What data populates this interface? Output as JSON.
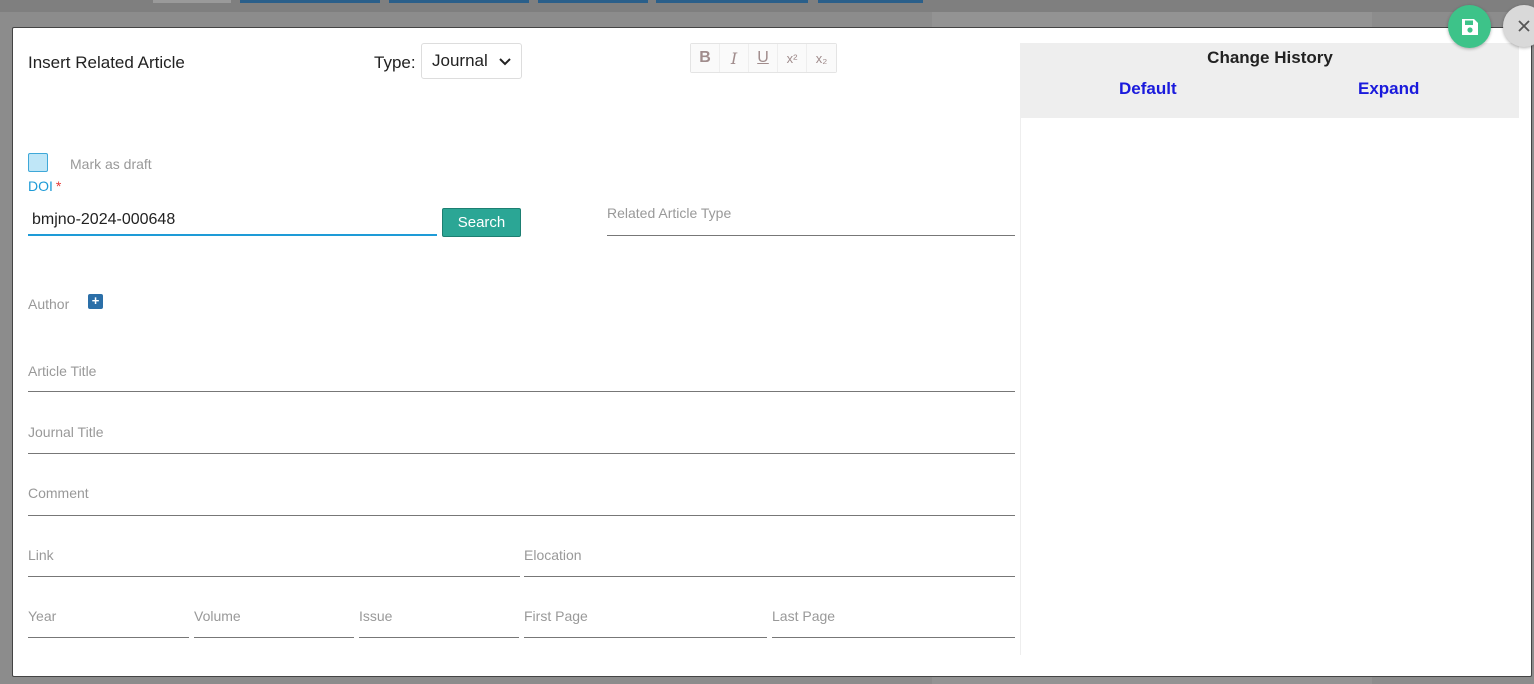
{
  "modal": {
    "title": "Insert Related Article",
    "type_label": "Type:",
    "type_value": "Journal",
    "format_buttons": [
      "B",
      "I",
      "U",
      "x²",
      "x₂"
    ],
    "draft_label": "Mark as draft",
    "doi_label": "DOI",
    "doi_required": "*",
    "doi_value": "bmjno-2024-000648",
    "search_label": "Search",
    "related_type_label": "Related Article Type",
    "author_label": "Author",
    "author_add": "+",
    "fields": {
      "article_title": "Article Title",
      "journal_title": "Journal Title",
      "comment": "Comment",
      "link": "Link",
      "elocation": "Elocation",
      "year": "Year",
      "volume": "Volume",
      "issue": "Issue",
      "first_page": "First Page",
      "last_page": "Last Page"
    }
  },
  "history": {
    "title": "Change History",
    "default_label": "Default",
    "expand_label": "Expand"
  },
  "colors": {
    "accent_blue": "#1e9bd7",
    "search_green": "#2ba695",
    "save_green": "#3dc389",
    "link_blue": "#1a1adc"
  }
}
